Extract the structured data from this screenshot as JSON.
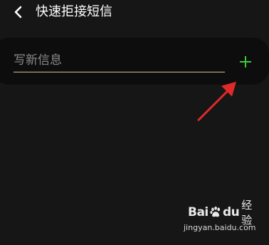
{
  "header": {
    "back_icon": "chevron-left-icon",
    "title": "快速拒接短信"
  },
  "compose": {
    "placeholder": "写新信息",
    "value": "",
    "add_icon": "plus-icon",
    "underline_color": "#d6c08a",
    "add_color": "#3ec83e"
  },
  "annotation": {
    "arrow_color": "#e02a2a",
    "arrow_icon": "red-arrow-pointer"
  },
  "watermark": {
    "brand_part1": "Bai",
    "brand_part2": "du",
    "product": "经验",
    "url": "jingyan.baidu.com"
  },
  "colors": {
    "background": "#161616",
    "card": "#0d0d0d",
    "text": "#ffffff"
  }
}
